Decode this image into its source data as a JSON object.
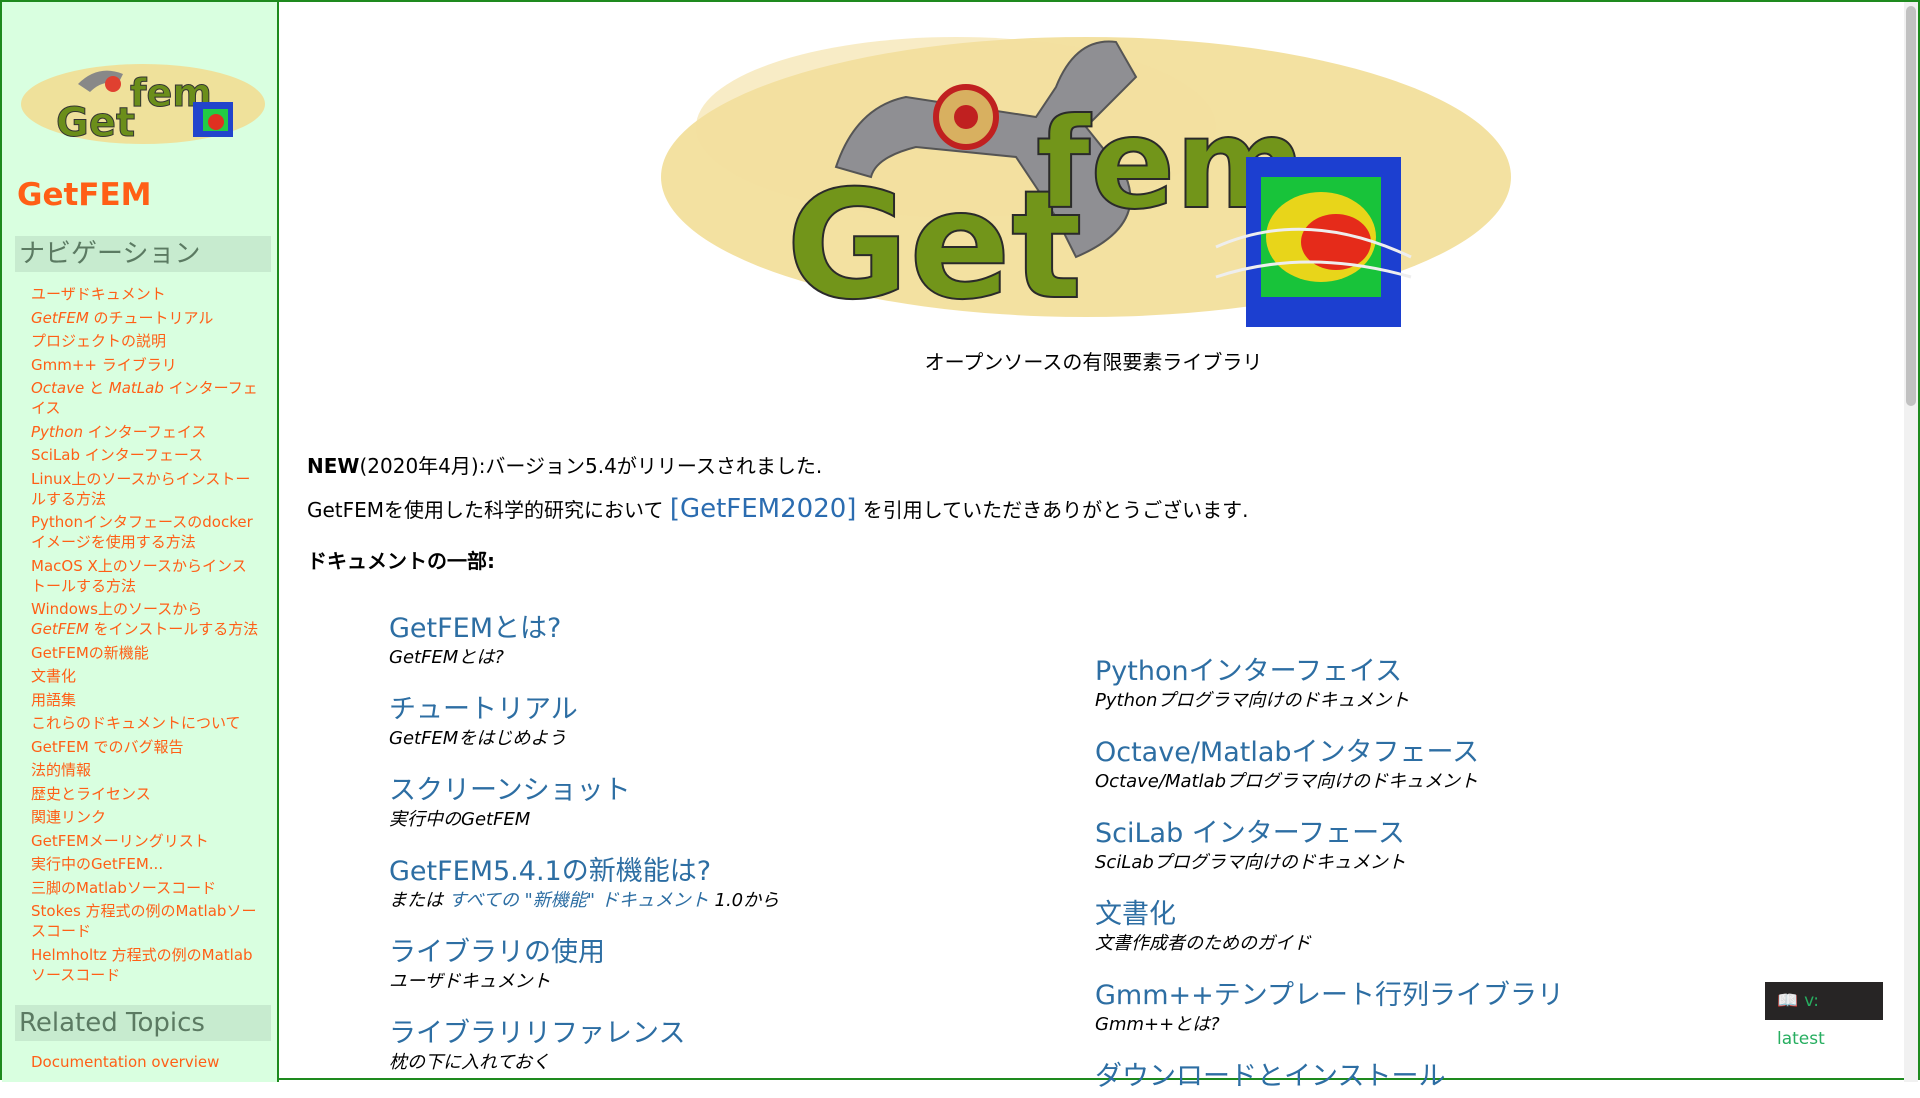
{
  "sidebar": {
    "project_title": "GetFEM",
    "nav_heading": "ナビゲーション",
    "nav_items": [
      {
        "label": "ユーザドキュメント"
      },
      {
        "label_italic": "GetFEM",
        "label": " のチュートリアル"
      },
      {
        "label": "プロジェクトの説明"
      },
      {
        "label": "Gmm++ ライブラリ"
      },
      {
        "label_italic": "Octave",
        "label": " と ",
        "label_italic2": "MatLab",
        "label2": " インターフェイス"
      },
      {
        "label_italic": "Python",
        "label": " インターフェイス"
      },
      {
        "label": "SciLab インターフェース"
      },
      {
        "label": "Linux上のソースからインストールする方法"
      },
      {
        "label": "Pythonインタフェースのdockerイメージを使用する方法"
      },
      {
        "label": "MacOS X上のソースからインストールする方法"
      },
      {
        "label": "Windows上のソースから ",
        "label_italic": "GetFEM",
        "label2": " をインストールする方法"
      },
      {
        "label": "GetFEMの新機能"
      },
      {
        "label": "文書化"
      },
      {
        "label": "用語集"
      },
      {
        "label": "これらのドキュメントについて"
      },
      {
        "label": "GetFEM でのバグ報告"
      },
      {
        "label": "法的情報"
      },
      {
        "label": "歴史とライセンス"
      },
      {
        "label": "関連リンク"
      },
      {
        "label": "GetFEMメーリングリスト"
      },
      {
        "label": "実行中のGetFEM..."
      },
      {
        "label": "三脚のMatlabソースコード"
      },
      {
        "label": "Stokes 方程式の例のMatlabソースコード"
      },
      {
        "label": "Helmholtz 方程式の例のMatlabソースコード"
      }
    ],
    "related_heading": "Related Topics",
    "related_items": [
      "Documentation overview"
    ]
  },
  "main": {
    "logo_text_get": "Get",
    "logo_text_fem": "fem",
    "tagline": "オープンソースの有限要素ライブラリ",
    "news_bold": "NEW",
    "news_text": "(2020年4月):バージョン5.4がリリースされました.",
    "cite_before": "GetFEMを使用した科学的研究において ",
    "cite_link": "[GetFEM2020]",
    "cite_after": " を引用していただきありがとうございます.",
    "doc_heading": "ドキュメントの一部:",
    "left_column": [
      {
        "title": "GetFEMとは?",
        "desc": "GetFEMとは?"
      },
      {
        "title": "チュートリアル",
        "desc": "GetFEMをはじめよう"
      },
      {
        "title": "スクリーンショット",
        "desc": "実行中のGetFEM"
      },
      {
        "title": "GetFEM5.4.1の新機能は?",
        "desc_before": "または ",
        "desc_link": "すべての \"新機能\" ドキュメント",
        "desc_after": " 1.0から"
      },
      {
        "title": "ライブラリの使用",
        "desc": "ユーザドキュメント"
      },
      {
        "title": "ライブラリリファレンス",
        "desc": "枕の下に入れておく"
      }
    ],
    "right_column": [
      {
        "title": "Pythonインターフェイス",
        "desc": "Pythonプログラマ向けのドキュメント"
      },
      {
        "title": "Octave/Matlabインタフェース",
        "desc": "Octave/Matlabプログラマ向けのドキュメント"
      },
      {
        "title": "SciLab インターフェース",
        "desc": "SciLabプログラマ向けのドキュメント"
      },
      {
        "title": "文書化",
        "desc": "文書作成者のためのガイド"
      },
      {
        "title": "Gmm++テンプレート行列ライブラリ",
        "desc": "Gmm++とは?"
      },
      {
        "title": "ダウンロードとインストール",
        "desc": ""
      }
    ]
  },
  "version_badge": {
    "label": "v: latest"
  },
  "colors": {
    "sidebar_bg": "#d9ffe0",
    "accent_orange": "#ff5f16",
    "link_blue": "#2d6ea3",
    "border_green": "#1e8a1e"
  }
}
